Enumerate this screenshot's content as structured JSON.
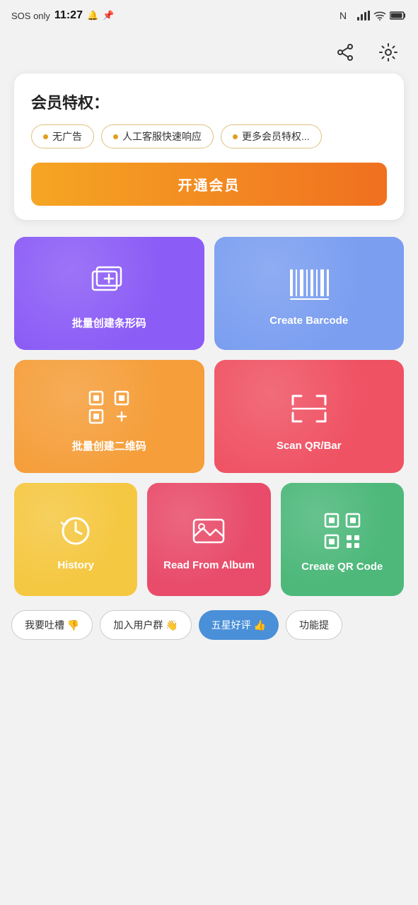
{
  "statusBar": {
    "left": "SOS only",
    "time": "11:27",
    "bell": "🔔",
    "pin": "📌"
  },
  "header": {
    "shareLabel": "share",
    "settingsLabel": "settings"
  },
  "membership": {
    "title": "会员特权：",
    "perks": [
      "无广告",
      "人工客服快速响应",
      "更多会员特权..."
    ],
    "buttonLabel": "开通会员"
  },
  "cards": [
    {
      "id": "batch-barcode",
      "label": "批量创建条形码",
      "color": "purple",
      "iconType": "batch-barcode"
    },
    {
      "id": "create-barcode",
      "label": "Create Barcode",
      "color": "blue",
      "iconType": "barcode"
    },
    {
      "id": "batch-qr",
      "label": "批量创建二维码",
      "color": "orange",
      "iconType": "batch-qr"
    },
    {
      "id": "scan-qr",
      "label": "Scan QR/Bar",
      "color": "red",
      "iconType": "scan"
    }
  ],
  "bottomCards": [
    {
      "id": "history",
      "label": "History",
      "color": "yellow",
      "iconType": "history"
    },
    {
      "id": "read-album",
      "label": "Read From Album",
      "color": "red2",
      "iconType": "album"
    },
    {
      "id": "create-qr",
      "label": "Create QR Code",
      "color": "green",
      "iconType": "qr"
    }
  ],
  "bottomButtons": [
    {
      "id": "feedback",
      "label": "我要吐槽 👎",
      "style": "outline"
    },
    {
      "id": "join-group",
      "label": "加入用户群 👋",
      "style": "outline"
    },
    {
      "id": "five-star",
      "label": "五星好评 👍",
      "style": "blue"
    },
    {
      "id": "more-features",
      "label": "功能提",
      "style": "outline"
    }
  ]
}
